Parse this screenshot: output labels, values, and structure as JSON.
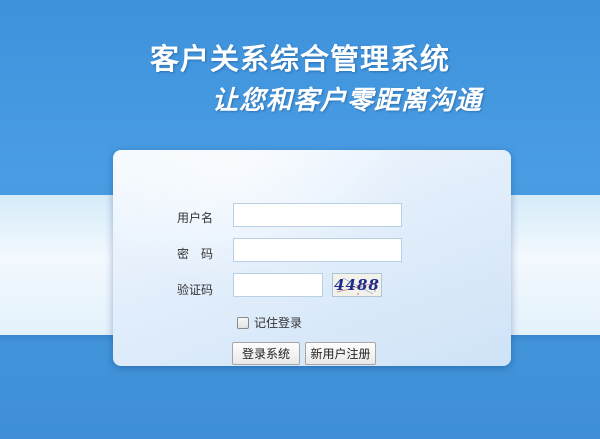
{
  "header": {
    "title": "客户关系综合管理系统",
    "slogan": "让您和客户零距离沟通"
  },
  "login_form": {
    "username_label": "用户名",
    "username_value": "",
    "password_label": "密　码",
    "password_value": "",
    "captcha_label": "验证码",
    "captcha_value": "",
    "captcha_image_text": "4488",
    "remember_label": "记住登录",
    "remember_checked": false,
    "login_button": "登录系统",
    "register_button": "新用户注册"
  }
}
